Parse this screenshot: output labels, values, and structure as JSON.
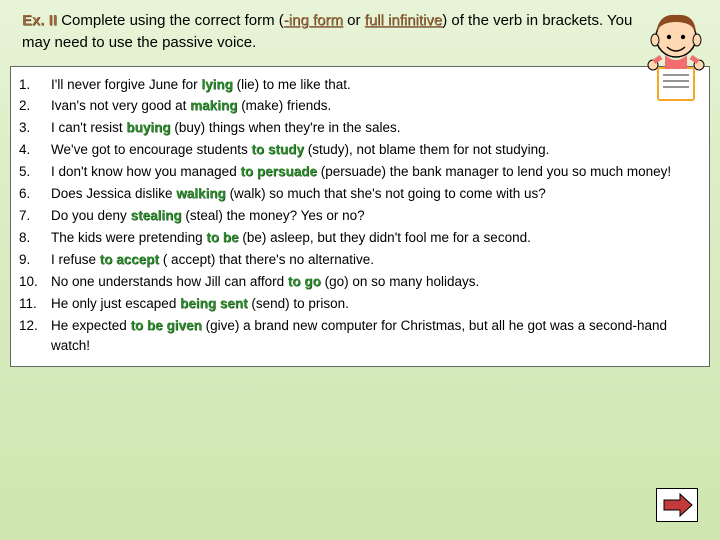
{
  "header": {
    "ex_label": "Ex. II",
    "instruction_1": "  Complete using the correct form (",
    "dash": "-",
    "ing_form": "ing form",
    "or": " or ",
    "full_inf": "full infinitive",
    "instruction_2": ") of the verb in brackets. You may need to use the passive voice."
  },
  "items": [
    {
      "n": "1.",
      "pre": "I'll never forgive June for   ",
      "ans": "lying",
      "post": "   (lie) to me like that."
    },
    {
      "n": "2.",
      "pre": "Ivan's not very good at   ",
      "ans": "making",
      "post": "        (make) friends."
    },
    {
      "n": "3.",
      "pre": "I can't resist      ",
      "ans": "buying",
      "post": "       (buy) things when they're in the sales."
    },
    {
      "n": "4.",
      "pre": "We've got to encourage students  ",
      "ans": "to study",
      "post": "   (study), not blame them for not studying."
    },
    {
      "n": "5.",
      "pre": "I don't know how you managed ",
      "ans": "to persuade",
      "post": "      (persuade) the bank manager to lend you so much money!"
    },
    {
      "n": "6.",
      "pre": "Does Jessica dislike     ",
      "ans": "walking",
      "post": "     (walk) so much that she's not going to come with us?"
    },
    {
      "n": "7.",
      "pre": "Do you deny ",
      "ans": "stealing",
      "post": "      (steal) the money? Yes or no?"
    },
    {
      "n": "8.",
      "pre": "The kids were  pretending  ",
      "ans": "to be",
      "post": "  (be) asleep, but they didn't fool me for a second."
    },
    {
      "n": "9.",
      "pre": "I refuse    ",
      "ans": "to accept",
      "post": " ( accept) that there's no alternative."
    },
    {
      "n": "10.",
      "pre": "No one understands how Jill can afford       ",
      "ans": "to go",
      "post": "     (go) on so many holidays."
    },
    {
      "n": "11.",
      "pre": "He only just escaped      ",
      "ans": "being sent",
      "post": "       (send) to prison."
    },
    {
      "n": "12.",
      "pre": "He expected          ",
      "ans": "to be given",
      "post": "               (give) a brand new computer for Christmas, but all he got was a second-hand watch!"
    }
  ]
}
